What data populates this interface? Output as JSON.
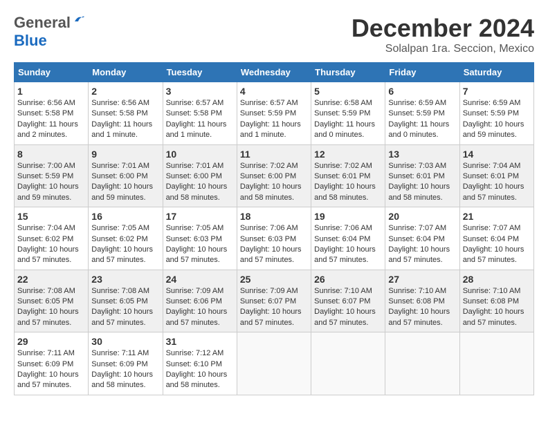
{
  "header": {
    "logo_general": "General",
    "logo_blue": "Blue",
    "month_title": "December 2024",
    "location": "Solalpan 1ra. Seccion, Mexico"
  },
  "weekdays": [
    "Sunday",
    "Monday",
    "Tuesday",
    "Wednesday",
    "Thursday",
    "Friday",
    "Saturday"
  ],
  "weeks": [
    [
      {
        "day": "1",
        "sunrise": "6:56 AM",
        "sunset": "5:58 PM",
        "daylight": "11 hours and 2 minutes."
      },
      {
        "day": "2",
        "sunrise": "6:56 AM",
        "sunset": "5:58 PM",
        "daylight": "11 hours and 1 minute."
      },
      {
        "day": "3",
        "sunrise": "6:57 AM",
        "sunset": "5:58 PM",
        "daylight": "11 hours and 1 minute."
      },
      {
        "day": "4",
        "sunrise": "6:57 AM",
        "sunset": "5:59 PM",
        "daylight": "11 hours and 1 minute."
      },
      {
        "day": "5",
        "sunrise": "6:58 AM",
        "sunset": "5:59 PM",
        "daylight": "11 hours and 0 minutes."
      },
      {
        "day": "6",
        "sunrise": "6:59 AM",
        "sunset": "5:59 PM",
        "daylight": "11 hours and 0 minutes."
      },
      {
        "day": "7",
        "sunrise": "6:59 AM",
        "sunset": "5:59 PM",
        "daylight": "10 hours and 59 minutes."
      }
    ],
    [
      {
        "day": "8",
        "sunrise": "7:00 AM",
        "sunset": "5:59 PM",
        "daylight": "10 hours and 59 minutes."
      },
      {
        "day": "9",
        "sunrise": "7:01 AM",
        "sunset": "6:00 PM",
        "daylight": "10 hours and 59 minutes."
      },
      {
        "day": "10",
        "sunrise": "7:01 AM",
        "sunset": "6:00 PM",
        "daylight": "10 hours and 58 minutes."
      },
      {
        "day": "11",
        "sunrise": "7:02 AM",
        "sunset": "6:00 PM",
        "daylight": "10 hours and 58 minutes."
      },
      {
        "day": "12",
        "sunrise": "7:02 AM",
        "sunset": "6:01 PM",
        "daylight": "10 hours and 58 minutes."
      },
      {
        "day": "13",
        "sunrise": "7:03 AM",
        "sunset": "6:01 PM",
        "daylight": "10 hours and 58 minutes."
      },
      {
        "day": "14",
        "sunrise": "7:04 AM",
        "sunset": "6:01 PM",
        "daylight": "10 hours and 57 minutes."
      }
    ],
    [
      {
        "day": "15",
        "sunrise": "7:04 AM",
        "sunset": "6:02 PM",
        "daylight": "10 hours and 57 minutes."
      },
      {
        "day": "16",
        "sunrise": "7:05 AM",
        "sunset": "6:02 PM",
        "daylight": "10 hours and 57 minutes."
      },
      {
        "day": "17",
        "sunrise": "7:05 AM",
        "sunset": "6:03 PM",
        "daylight": "10 hours and 57 minutes."
      },
      {
        "day": "18",
        "sunrise": "7:06 AM",
        "sunset": "6:03 PM",
        "daylight": "10 hours and 57 minutes."
      },
      {
        "day": "19",
        "sunrise": "7:06 AM",
        "sunset": "6:04 PM",
        "daylight": "10 hours and 57 minutes."
      },
      {
        "day": "20",
        "sunrise": "7:07 AM",
        "sunset": "6:04 PM",
        "daylight": "10 hours and 57 minutes."
      },
      {
        "day": "21",
        "sunrise": "7:07 AM",
        "sunset": "6:04 PM",
        "daylight": "10 hours and 57 minutes."
      }
    ],
    [
      {
        "day": "22",
        "sunrise": "7:08 AM",
        "sunset": "6:05 PM",
        "daylight": "10 hours and 57 minutes."
      },
      {
        "day": "23",
        "sunrise": "7:08 AM",
        "sunset": "6:05 PM",
        "daylight": "10 hours and 57 minutes."
      },
      {
        "day": "24",
        "sunrise": "7:09 AM",
        "sunset": "6:06 PM",
        "daylight": "10 hours and 57 minutes."
      },
      {
        "day": "25",
        "sunrise": "7:09 AM",
        "sunset": "6:07 PM",
        "daylight": "10 hours and 57 minutes."
      },
      {
        "day": "26",
        "sunrise": "7:10 AM",
        "sunset": "6:07 PM",
        "daylight": "10 hours and 57 minutes."
      },
      {
        "day": "27",
        "sunrise": "7:10 AM",
        "sunset": "6:08 PM",
        "daylight": "10 hours and 57 minutes."
      },
      {
        "day": "28",
        "sunrise": "7:10 AM",
        "sunset": "6:08 PM",
        "daylight": "10 hours and 57 minutes."
      }
    ],
    [
      {
        "day": "29",
        "sunrise": "7:11 AM",
        "sunset": "6:09 PM",
        "daylight": "10 hours and 57 minutes."
      },
      {
        "day": "30",
        "sunrise": "7:11 AM",
        "sunset": "6:09 PM",
        "daylight": "10 hours and 58 minutes."
      },
      {
        "day": "31",
        "sunrise": "7:12 AM",
        "sunset": "6:10 PM",
        "daylight": "10 hours and 58 minutes."
      },
      null,
      null,
      null,
      null
    ]
  ]
}
